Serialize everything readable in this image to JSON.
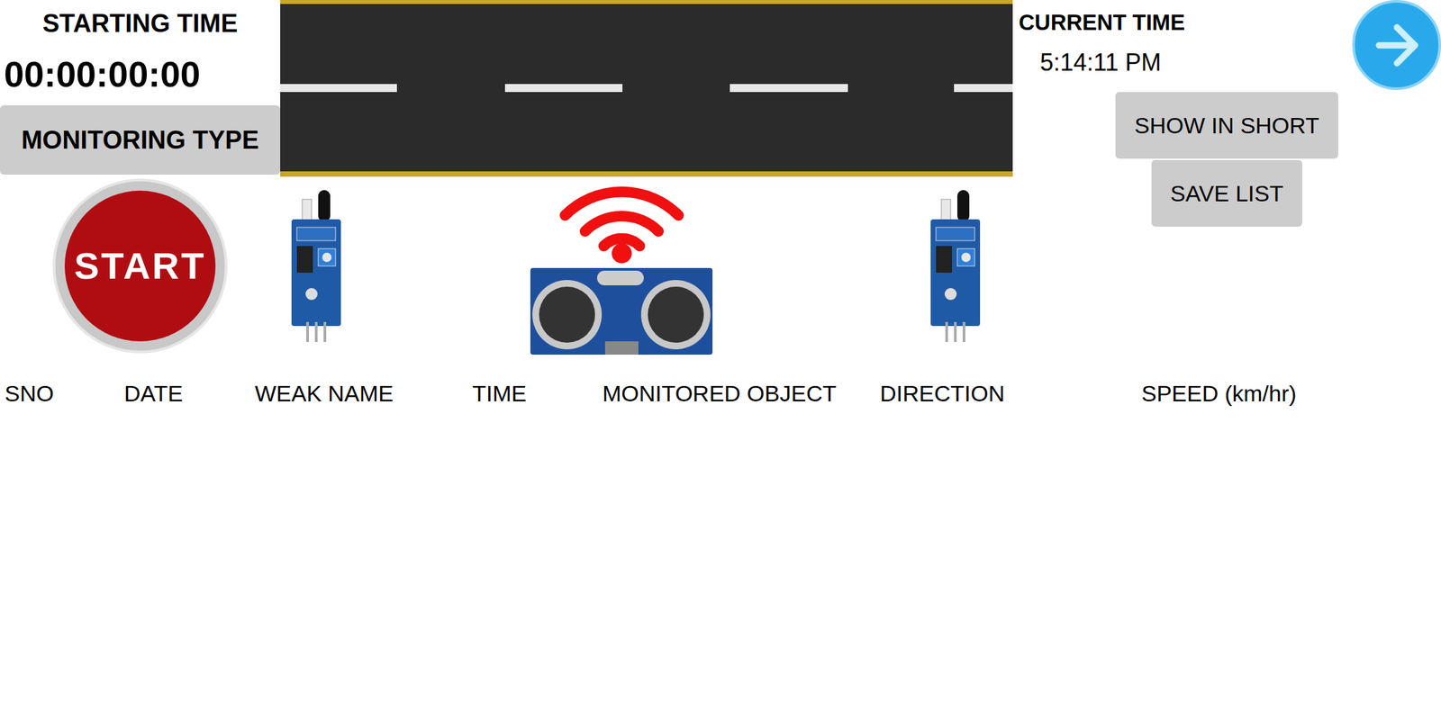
{
  "starting_time": {
    "label": "STARTING TIME",
    "value": "00:00:00:00"
  },
  "monitoring_type": {
    "label": "MONITORING TYPE"
  },
  "start_button": {
    "label": "START"
  },
  "current_time": {
    "label": "CURRENT TIME",
    "value": "5:14:11 PM"
  },
  "buttons": [
    {
      "label": "SHOW IN SHORT"
    },
    {
      "label": "SAVE LIST"
    }
  ],
  "table": {
    "columns": [
      "SNO",
      "DATE",
      "WEAK NAME",
      "TIME",
      "MONITORED OBJECT",
      "DIRECTION",
      "SPEED (km/hr)"
    ],
    "rows": []
  }
}
